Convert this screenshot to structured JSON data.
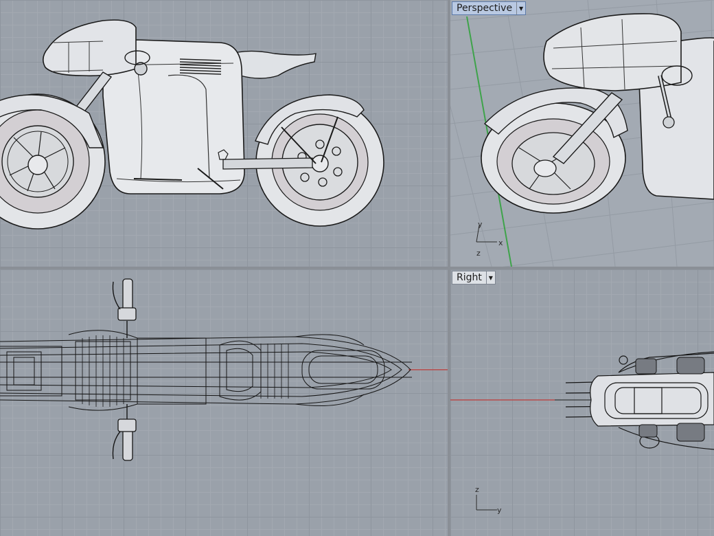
{
  "viewports": {
    "top_left": {
      "label": ""
    },
    "perspective": {
      "label": "Perspective",
      "active": true,
      "axes": {
        "x": "x",
        "y": "y",
        "z": "z"
      }
    },
    "top": {
      "label": ""
    },
    "right": {
      "label": "Right",
      "axes": {
        "y": "y",
        "z": "z"
      }
    }
  },
  "menu_arrow_icon": "dropdown-triangle",
  "colors": {
    "viewport_bg": "#9aa1aa",
    "active_tab": "#b9c9e2",
    "x_axis": "#b84a4a",
    "y_axis": "#3ea34a",
    "model_fill": "#e4e6ea",
    "wire": "#1a1a1a"
  }
}
